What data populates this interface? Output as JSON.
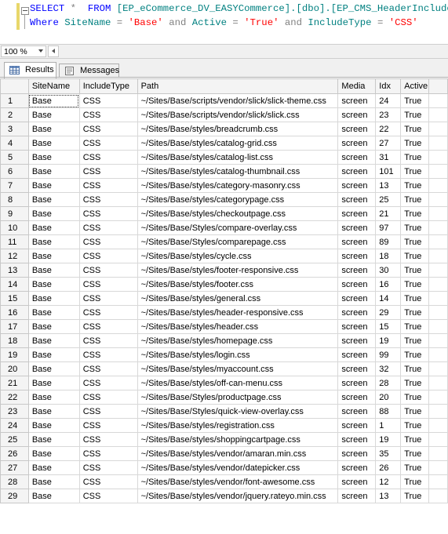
{
  "editor": {
    "line1": {
      "kw_select": "SELECT",
      "star": "*",
      "kw_from": "FROM",
      "table_name": "[EP_eCommerce_DV_EASYCommerce].[dbo].[EP_CMS_HeaderIncludes]"
    },
    "line2": {
      "kw_where": "Where",
      "col1": "SiteName",
      "eq1": "=",
      "val1": "'Base'",
      "and1": "and",
      "col2": "Active",
      "eq2": "=",
      "val2": "'True'",
      "and2": "and",
      "col3": "IncludeType",
      "eq3": "=",
      "val3": "'CSS'"
    }
  },
  "zoom": {
    "value": "100 %"
  },
  "tabs": {
    "results": "Results",
    "messages": "Messages"
  },
  "grid": {
    "columns": [
      "SiteName",
      "IncludeType",
      "Path",
      "Media",
      "Idx",
      "Active"
    ],
    "rows": [
      [
        "1",
        "Base",
        "CSS",
        "~/Sites/Base/scripts/vendor/slick/slick-theme.css",
        "screen",
        "24",
        "True"
      ],
      [
        "2",
        "Base",
        "CSS",
        "~/Sites/Base/scripts/vendor/slick/slick.css",
        "screen",
        "23",
        "True"
      ],
      [
        "3",
        "Base",
        "CSS",
        "~/Sites/Base/styles/breadcrumb.css",
        "screen",
        "22",
        "True"
      ],
      [
        "4",
        "Base",
        "CSS",
        "~/Sites/Base/styles/catalog-grid.css",
        "screen",
        "27",
        "True"
      ],
      [
        "5",
        "Base",
        "CSS",
        "~/Sites/Base/styles/catalog-list.css",
        "screen",
        "31",
        "True"
      ],
      [
        "6",
        "Base",
        "CSS",
        "~/Sites/Base/styles/catalog-thumbnail.css",
        "screen",
        "101",
        "True"
      ],
      [
        "7",
        "Base",
        "CSS",
        "~/Sites/Base/styles/category-masonry.css",
        "screen",
        "13",
        "True"
      ],
      [
        "8",
        "Base",
        "CSS",
        "~/Sites/Base/styles/categorypage.css",
        "screen",
        "25",
        "True"
      ],
      [
        "9",
        "Base",
        "CSS",
        "~/Sites/Base/styles/checkoutpage.css",
        "screen",
        "21",
        "True"
      ],
      [
        "10",
        "Base",
        "CSS",
        "~/Sites/Base/Styles/compare-overlay.css",
        "screen",
        "97",
        "True"
      ],
      [
        "11",
        "Base",
        "CSS",
        "~/Sites/Base/Styles/comparepage.css",
        "screen",
        "89",
        "True"
      ],
      [
        "12",
        "Base",
        "CSS",
        "~/Sites/Base/styles/cycle.css",
        "screen",
        "18",
        "True"
      ],
      [
        "13",
        "Base",
        "CSS",
        "~/Sites/Base/styles/footer-responsive.css",
        "screen",
        "30",
        "True"
      ],
      [
        "14",
        "Base",
        "CSS",
        "~/Sites/Base/styles/footer.css",
        "screen",
        "16",
        "True"
      ],
      [
        "15",
        "Base",
        "CSS",
        "~/Sites/Base/styles/general.css",
        "screen",
        "14",
        "True"
      ],
      [
        "16",
        "Base",
        "CSS",
        "~/Sites/Base/styles/header-responsive.css",
        "screen",
        "29",
        "True"
      ],
      [
        "17",
        "Base",
        "CSS",
        "~/Sites/Base/styles/header.css",
        "screen",
        "15",
        "True"
      ],
      [
        "18",
        "Base",
        "CSS",
        "~/Sites/Base/styles/homepage.css",
        "screen",
        "19",
        "True"
      ],
      [
        "19",
        "Base",
        "CSS",
        "~/Sites/Base/styles/login.css",
        "screen",
        "99",
        "True"
      ],
      [
        "20",
        "Base",
        "CSS",
        "~/Sites/Base/styles/myaccount.css",
        "screen",
        "32",
        "True"
      ],
      [
        "21",
        "Base",
        "CSS",
        "~/Sites/Base/styles/off-can-menu.css",
        "screen",
        "28",
        "True"
      ],
      [
        "22",
        "Base",
        "CSS",
        "~/Sites/Base/Styles/productpage.css",
        "screen",
        "20",
        "True"
      ],
      [
        "23",
        "Base",
        "CSS",
        "~/Sites/Base/Styles/quick-view-overlay.css",
        "screen",
        "88",
        "True"
      ],
      [
        "24",
        "Base",
        "CSS",
        "~/Sites/Base/styles/registration.css",
        "screen",
        "1",
        "True"
      ],
      [
        "25",
        "Base",
        "CSS",
        "~/Sites/Base/styles/shoppingcartpage.css",
        "screen",
        "19",
        "True"
      ],
      [
        "26",
        "Base",
        "CSS",
        "~/Sites/Base/styles/vendor/amaran.min.css",
        "screen",
        "35",
        "True"
      ],
      [
        "27",
        "Base",
        "CSS",
        "~/Sites/Base/styles/vendor/datepicker.css",
        "screen",
        "26",
        "True"
      ],
      [
        "28",
        "Base",
        "CSS",
        "~/Sites/Base/styles/vendor/font-awesome.css",
        "screen",
        "12",
        "True"
      ],
      [
        "29",
        "Base",
        "CSS",
        "~/Sites/Base/styles/vendor/jquery.rateyo.min.css",
        "screen",
        "13",
        "True"
      ]
    ]
  }
}
